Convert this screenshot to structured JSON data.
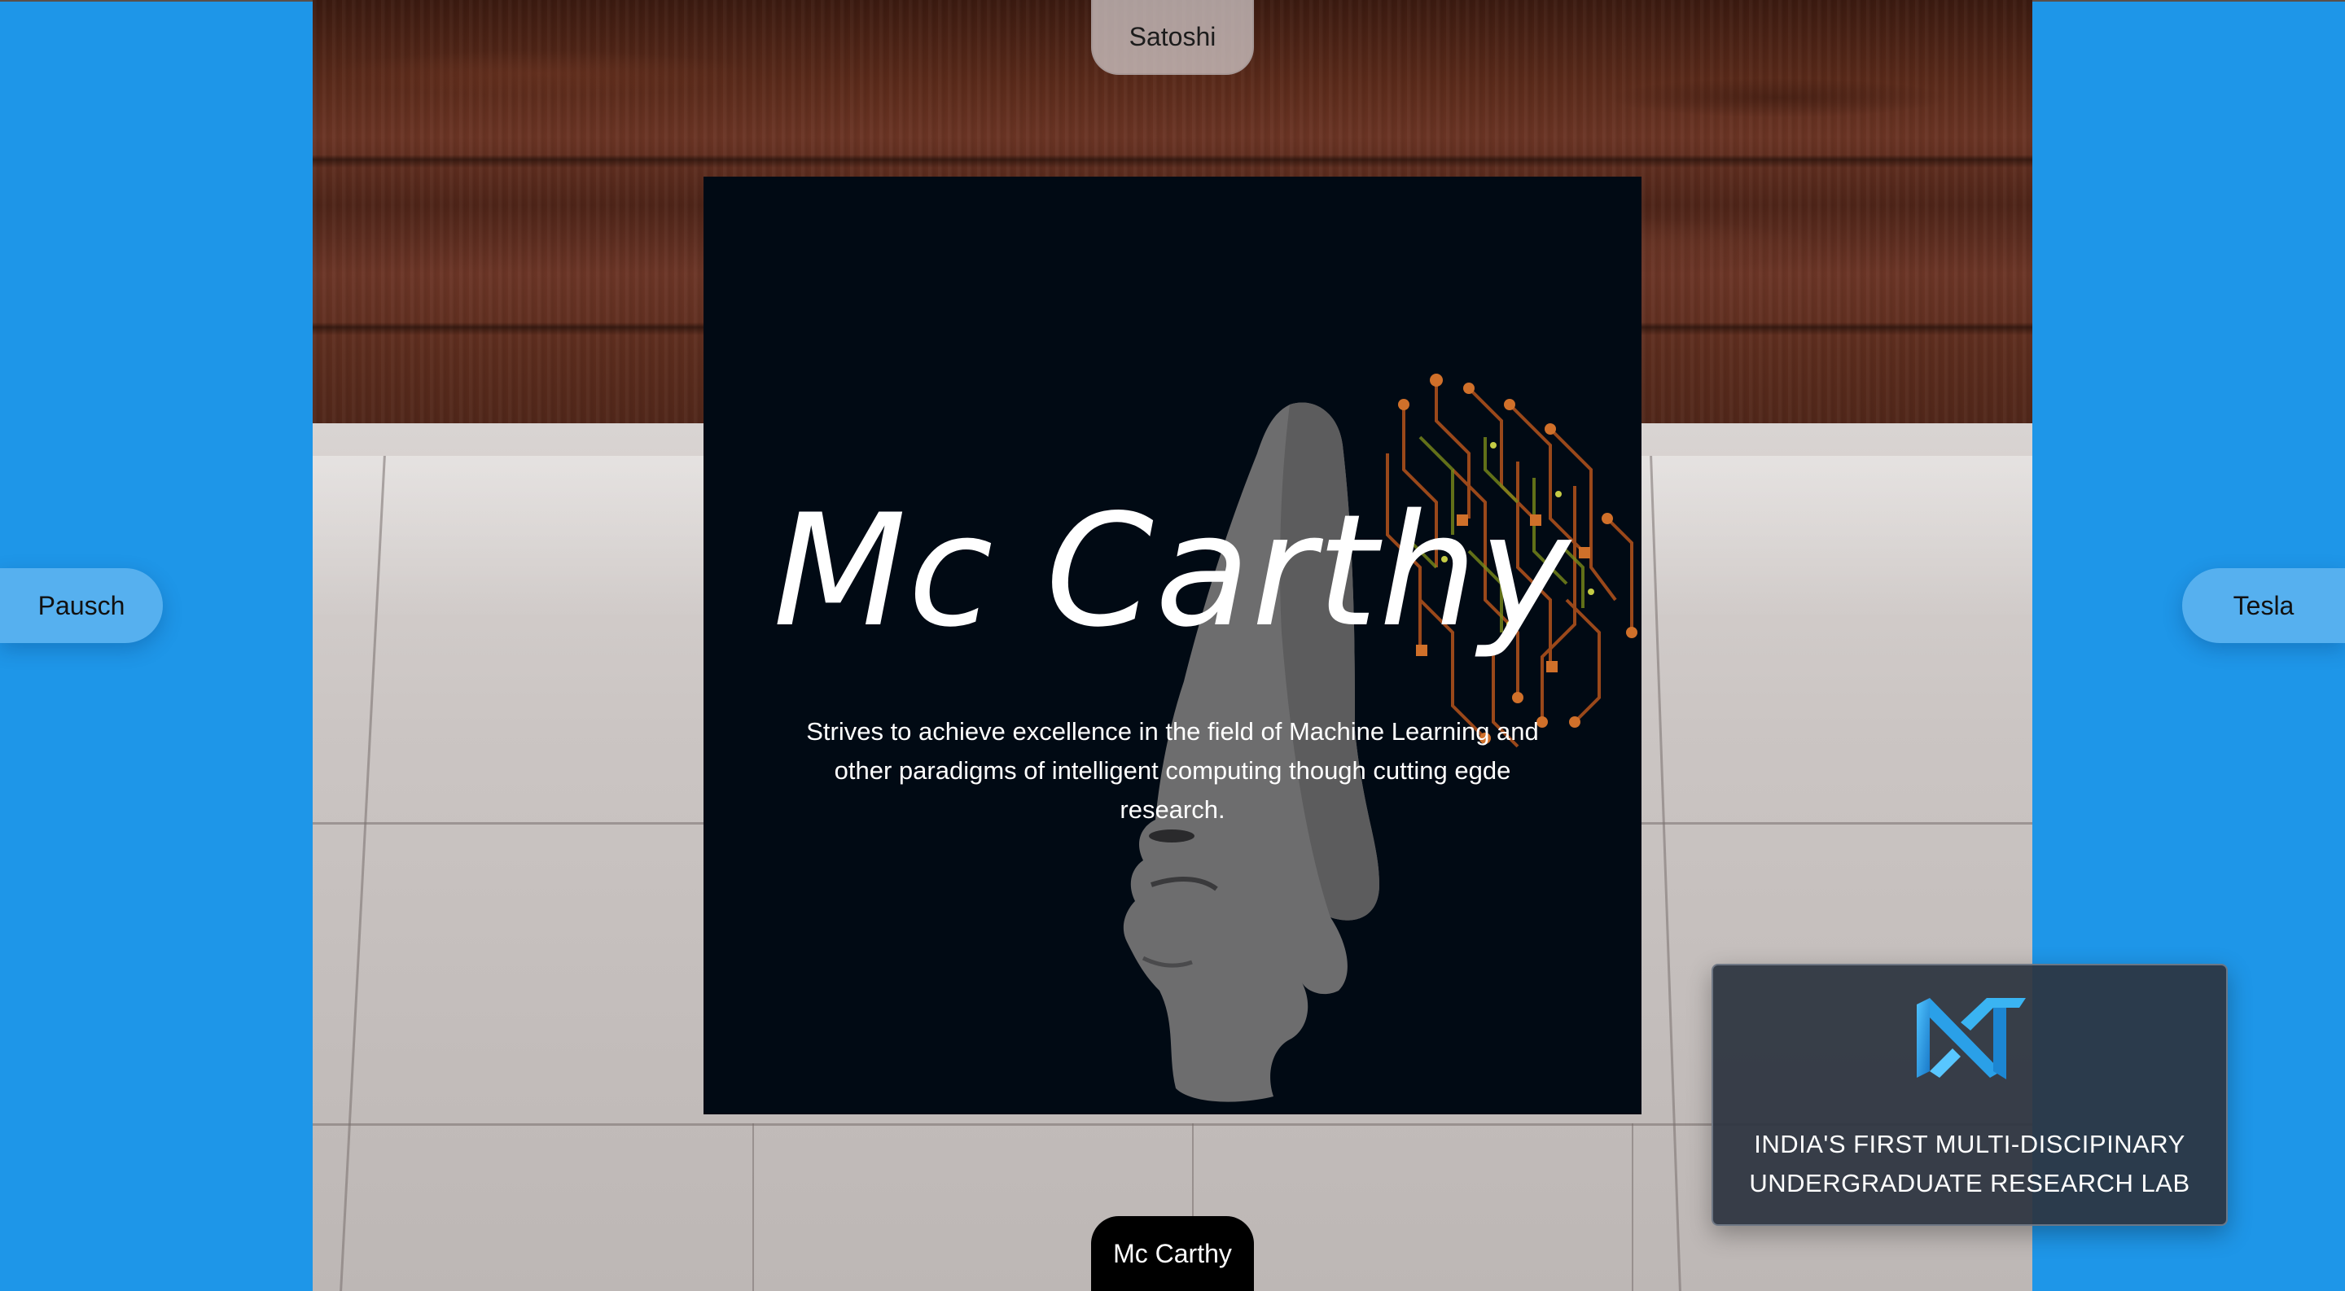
{
  "navigation": {
    "top": "Satoshi",
    "left": "Pausch",
    "right": "Tesla",
    "bottom": "Mc Carthy"
  },
  "hero": {
    "title": "Mc Carthy",
    "description": "Strives to achieve excellence in the field of Machine Learning and other paradigms of intelligent computing though cutting egde research."
  },
  "lab": {
    "tagline_line1": "INDIA'S FIRST MULTI-DISCIPINARY",
    "tagline_line2": "UNDERGRADUATE RESEARCH LAB"
  },
  "colors": {
    "background": "#1e96e8",
    "card": "#010a14",
    "pill_blue": "#56b0ef",
    "lab_card": "#2c3440",
    "logo_blue": "#2aa0e8"
  }
}
